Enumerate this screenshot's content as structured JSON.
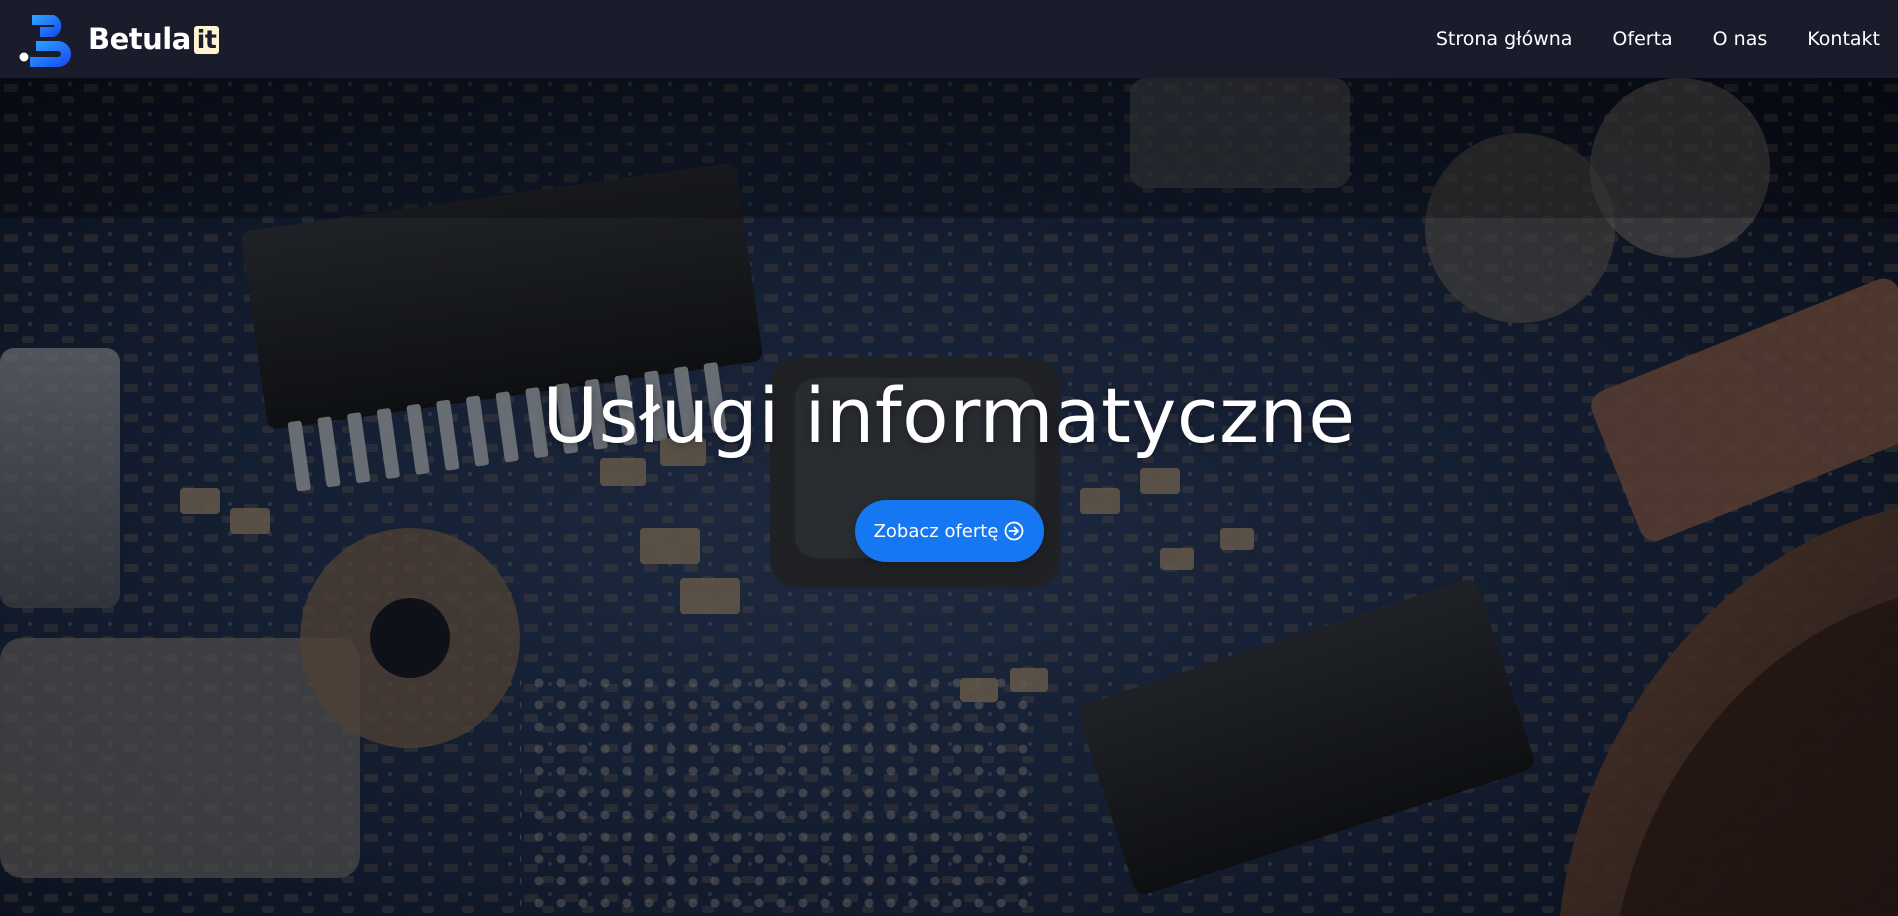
{
  "brand": {
    "name": "Betula",
    "badge": "it",
    "accent_color": "#1677f2"
  },
  "nav": {
    "items": [
      {
        "label": "Strona główna"
      },
      {
        "label": "Oferta"
      },
      {
        "label": "O nas"
      },
      {
        "label": "Kontakt"
      }
    ]
  },
  "hero": {
    "background": "circuit-board-photo",
    "title": "Usługi informatyczne",
    "cta_label": "Zobacz ofertę",
    "cta_icon": "arrow-right-circle-icon"
  },
  "colors": {
    "navbar_bg": "#1a1b2b",
    "button_bg": "#1677f2",
    "badge_bg": "#fff3d1"
  }
}
